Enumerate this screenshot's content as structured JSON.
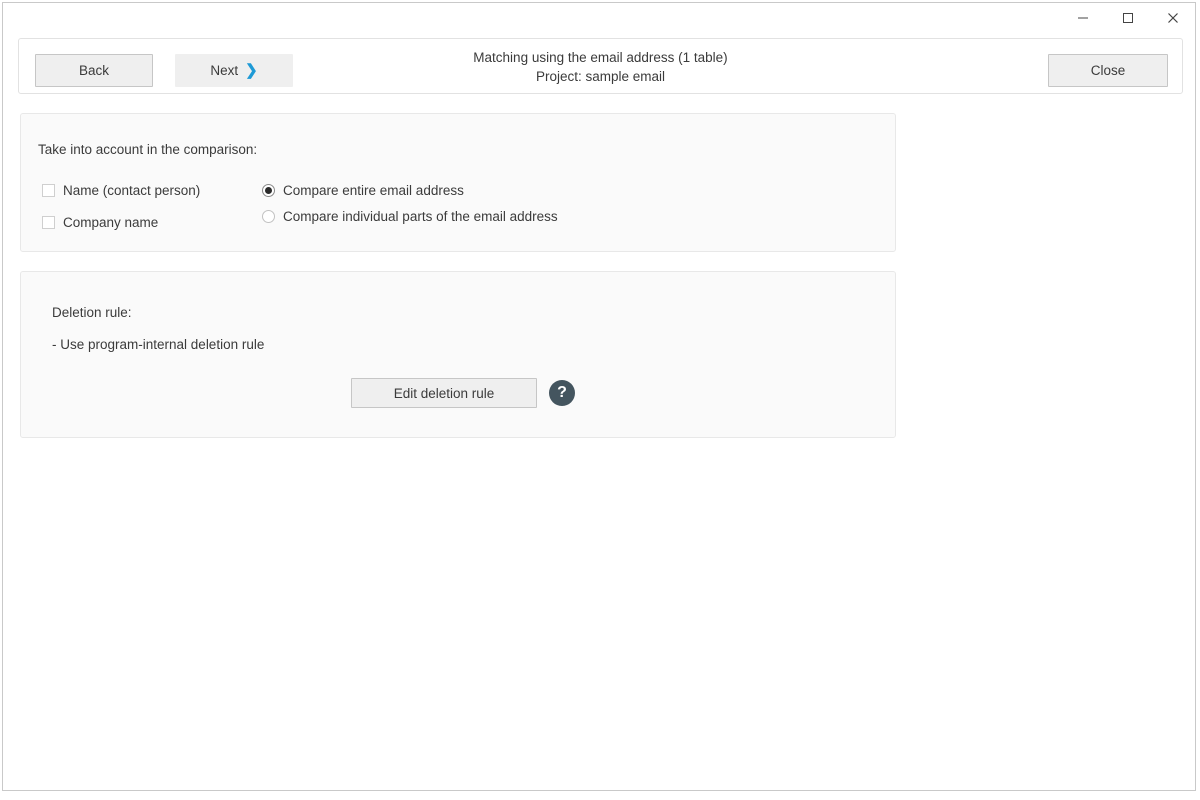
{
  "window": {
    "controls": [
      {
        "name": "minimize-button",
        "label": "—"
      },
      {
        "name": "maximize-button",
        "label": "□"
      },
      {
        "name": "close-window-button",
        "label": "✕"
      }
    ]
  },
  "toolbar": {
    "back_label": "Back",
    "next_label": "Next",
    "next_chevron": "❯",
    "close_label": "Close",
    "title": "Matching using the email address (1 table)",
    "subtitle": "Project: sample email"
  },
  "comparison_panel": {
    "heading": "Take into account in the comparison:",
    "checkboxes": [
      {
        "label": "Name (contact person)",
        "checked": false
      },
      {
        "label": "Company name",
        "checked": false
      }
    ],
    "radios": [
      {
        "label": "Compare entire email address",
        "selected": true
      },
      {
        "label": "Compare individual parts of the email address",
        "selected": false
      }
    ]
  },
  "deletion_panel": {
    "heading": "Deletion rule:",
    "rule_text": "- Use program-internal deletion rule",
    "edit_button_label": "Edit deletion rule",
    "help_icon_label": "?"
  },
  "colors": {
    "accent_chevron": "#1e9ad6",
    "help_icon_bg": "#44555f",
    "text": "#3b3b3b",
    "panel_bg": "#fafafa",
    "button_bg": "#efefef"
  }
}
